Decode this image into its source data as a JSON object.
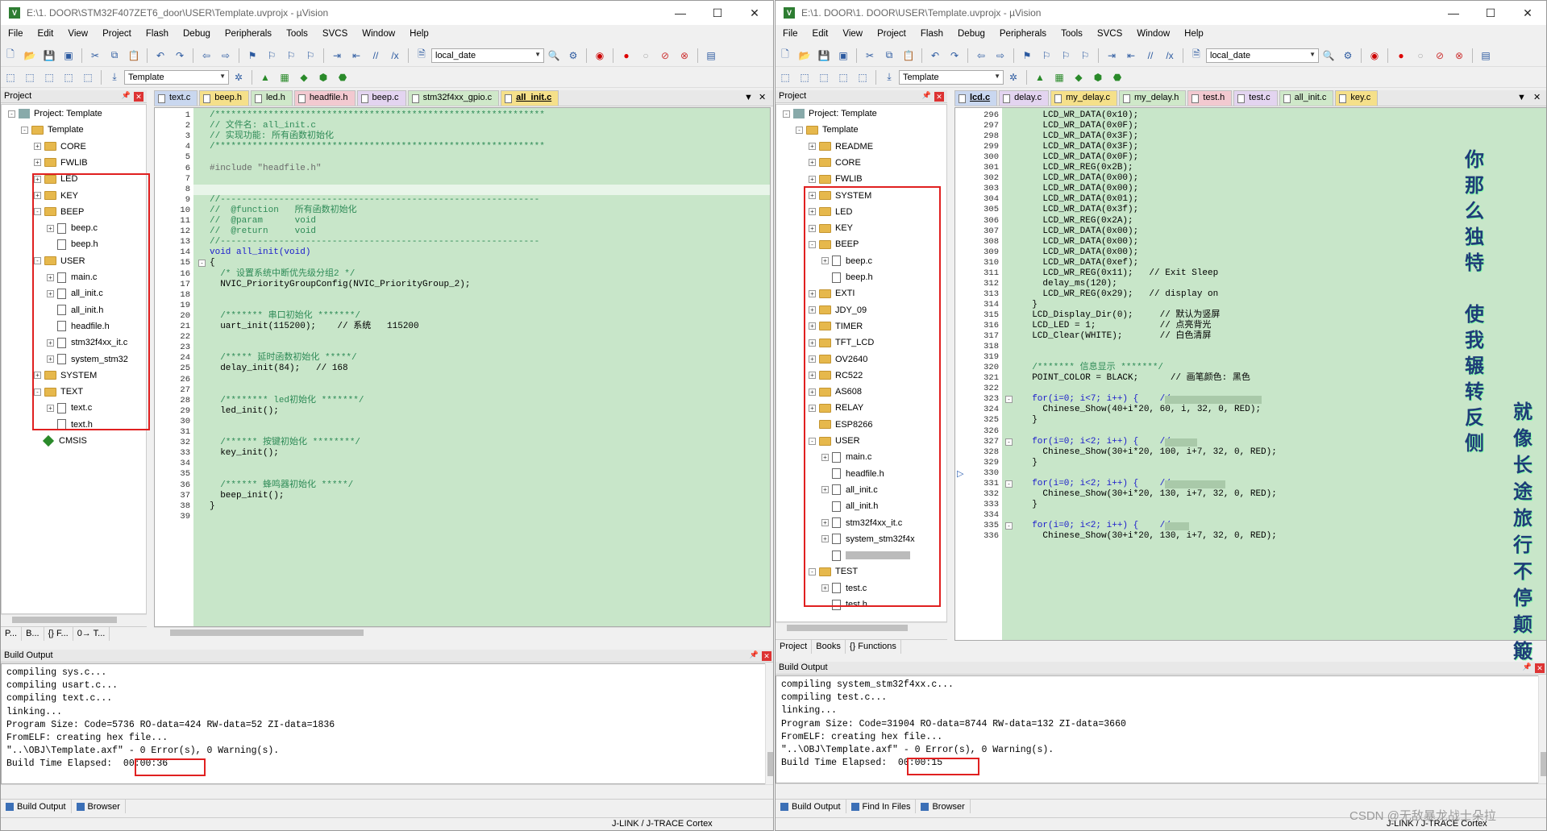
{
  "left": {
    "title": "E:\\1. DOOR\\STM32F407ZET6_door\\USER\\Template.uvprojx - µVision",
    "menu": [
      "File",
      "Edit",
      "View",
      "Project",
      "Flash",
      "Debug",
      "Peripherals",
      "Tools",
      "SVCS",
      "Window",
      "Help"
    ],
    "combo_date": "local_date",
    "combo_target": "Template",
    "panel_title": "Project",
    "tree": [
      {
        "label": "Project: Template",
        "lvl": 0,
        "kind": "proj",
        "exp": "-"
      },
      {
        "label": "Template",
        "lvl": 1,
        "kind": "fold",
        "exp": "-"
      },
      {
        "label": "CORE",
        "lvl": 2,
        "kind": "fold",
        "exp": "+"
      },
      {
        "label": "FWLIB",
        "lvl": 2,
        "kind": "fold",
        "exp": "+"
      },
      {
        "label": "LED",
        "lvl": 2,
        "kind": "fold",
        "exp": "+"
      },
      {
        "label": "KEY",
        "lvl": 2,
        "kind": "fold",
        "exp": "+"
      },
      {
        "label": "BEEP",
        "lvl": 2,
        "kind": "fold",
        "exp": "-"
      },
      {
        "label": "beep.c",
        "lvl": 3,
        "kind": "file",
        "exp": "+"
      },
      {
        "label": "beep.h",
        "lvl": 3,
        "kind": "file",
        "exp": ""
      },
      {
        "label": "USER",
        "lvl": 2,
        "kind": "fold",
        "exp": "-"
      },
      {
        "label": "main.c",
        "lvl": 3,
        "kind": "file",
        "exp": "+"
      },
      {
        "label": "all_init.c",
        "lvl": 3,
        "kind": "file",
        "exp": "+"
      },
      {
        "label": "all_init.h",
        "lvl": 3,
        "kind": "file",
        "exp": ""
      },
      {
        "label": "headfile.h",
        "lvl": 3,
        "kind": "file",
        "exp": ""
      },
      {
        "label": "stm32f4xx_it.c",
        "lvl": 3,
        "kind": "file",
        "exp": "+"
      },
      {
        "label": "system_stm32",
        "lvl": 3,
        "kind": "file",
        "exp": "+"
      },
      {
        "label": "SYSTEM",
        "lvl": 2,
        "kind": "fold",
        "exp": "+"
      },
      {
        "label": "TEXT",
        "lvl": 2,
        "kind": "fold",
        "exp": "-"
      },
      {
        "label": "text.c",
        "lvl": 3,
        "kind": "file",
        "exp": "+"
      },
      {
        "label": "text.h",
        "lvl": 3,
        "kind": "file",
        "exp": ""
      },
      {
        "label": "CMSIS",
        "lvl": 2,
        "kind": "diam",
        "exp": ""
      }
    ],
    "tabs": [
      "text.c",
      "beep.h",
      "led.h",
      "headfile.h",
      "beep.c",
      "stm32f4xx_gpio.c",
      "all_init.c"
    ],
    "tab_colors": [
      "#c9d7ef",
      "#f5e08a",
      "#cfe8c9",
      "#f2c9d0",
      "#e3d4f0",
      "#cfe8c9",
      "#f5e08a"
    ],
    "active_tab": 6,
    "project_tabs": [
      "P...",
      "B...",
      "{} F...",
      "0→ T..."
    ],
    "code": [
      {
        "n": "1",
        "t": "/**************************************************************",
        "c": "c"
      },
      {
        "n": "2",
        "t": "// 文件名: all_init.c",
        "c": "c"
      },
      {
        "n": "3",
        "t": "// 实现功能: 所有函数初始化",
        "c": "c"
      },
      {
        "n": "4",
        "t": "/**************************************************************",
        "c": "c"
      },
      {
        "n": "5",
        "t": "",
        "c": ""
      },
      {
        "n": "6",
        "t": "#include \"headfile.h\"",
        "c": "p"
      },
      {
        "n": "7",
        "t": "",
        "c": ""
      },
      {
        "n": "8",
        "t": "",
        "c": ""
      },
      {
        "n": "9",
        "t": "//------------------------------------------------------------",
        "c": "c"
      },
      {
        "n": "10",
        "t": "//  @function   所有函数初始化",
        "c": "c"
      },
      {
        "n": "11",
        "t": "//  @param      void",
        "c": "c"
      },
      {
        "n": "12",
        "t": "//  @return     void",
        "c": "c"
      },
      {
        "n": "13",
        "t": "//------------------------------------------------------------",
        "c": "c"
      },
      {
        "n": "14",
        "t": "void all_init(void)",
        "c": "k"
      },
      {
        "n": "15",
        "t": "{",
        "c": ""
      },
      {
        "n": "16",
        "t": "  /* 设置系统中断优先级分组2 */",
        "c": "c"
      },
      {
        "n": "17",
        "t": "  NVIC_PriorityGroupConfig(NVIC_PriorityGroup_2);",
        "c": ""
      },
      {
        "n": "18",
        "t": "",
        "c": ""
      },
      {
        "n": "19",
        "t": "",
        "c": ""
      },
      {
        "n": "20",
        "t": "  /******* 串口初始化 *******/",
        "c": "c"
      },
      {
        "n": "21",
        "t": "  uart_init(115200);    // 系统   115200",
        "c": ""
      },
      {
        "n": "22",
        "t": "",
        "c": ""
      },
      {
        "n": "23",
        "t": "",
        "c": ""
      },
      {
        "n": "24",
        "t": "  /***** 延时函数初始化 *****/",
        "c": "c"
      },
      {
        "n": "25",
        "t": "  delay_init(84);   // 168",
        "c": ""
      },
      {
        "n": "26",
        "t": "",
        "c": ""
      },
      {
        "n": "27",
        "t": "",
        "c": ""
      },
      {
        "n": "28",
        "t": "  /******** led初始化 *******/",
        "c": "c"
      },
      {
        "n": "29",
        "t": "  led_init();",
        "c": ""
      },
      {
        "n": "30",
        "t": "",
        "c": ""
      },
      {
        "n": "31",
        "t": "",
        "c": ""
      },
      {
        "n": "32",
        "t": "  /****** 按键初始化 ********/",
        "c": "c"
      },
      {
        "n": "33",
        "t": "  key_init();",
        "c": ""
      },
      {
        "n": "34",
        "t": "",
        "c": ""
      },
      {
        "n": "35",
        "t": "",
        "c": ""
      },
      {
        "n": "36",
        "t": "  /****** 蜂鸣器初始化 *****/",
        "c": "c"
      },
      {
        "n": "37",
        "t": "  beep_init();",
        "c": ""
      },
      {
        "n": "38",
        "t": "}",
        "c": ""
      },
      {
        "n": "39",
        "t": "",
        "c": ""
      }
    ],
    "build_title": "Build Output",
    "build": [
      "compiling sys.c...",
      "compiling usart.c...",
      "compiling text.c...",
      "linking...",
      "Program Size: Code=5736 RO-data=424 RW-data=52 ZI-data=1836",
      "FromELF: creating hex file...",
      "\"..\\OBJ\\Template.axf\" - 0 Error(s), 0 Warning(s).",
      "Build Time Elapsed:  00:00:36"
    ],
    "build_tabs": [
      "Build Output",
      "Browser"
    ],
    "status": "J-LINK / J-TRACE Cortex"
  },
  "right": {
    "title": "E:\\1. DOOR\\1. DOOR\\USER\\Template.uvprojx - µVision",
    "menu": [
      "File",
      "Edit",
      "View",
      "Project",
      "Flash",
      "Debug",
      "Peripherals",
      "Tools",
      "SVCS",
      "Window",
      "Help"
    ],
    "combo_date": "local_date",
    "combo_target": "Template",
    "panel_title": "Project",
    "tree": [
      {
        "label": "Project: Template",
        "lvl": 0,
        "kind": "proj",
        "exp": "-"
      },
      {
        "label": "Template",
        "lvl": 1,
        "kind": "fold",
        "exp": "-"
      },
      {
        "label": "README",
        "lvl": 2,
        "kind": "fold",
        "exp": "+"
      },
      {
        "label": "CORE",
        "lvl": 2,
        "kind": "fold",
        "exp": "+"
      },
      {
        "label": "FWLIB",
        "lvl": 2,
        "kind": "fold",
        "exp": "+"
      },
      {
        "label": "SYSTEM",
        "lvl": 2,
        "kind": "fold",
        "exp": "+"
      },
      {
        "label": "LED",
        "lvl": 2,
        "kind": "fold",
        "exp": "+"
      },
      {
        "label": "KEY",
        "lvl": 2,
        "kind": "fold",
        "exp": "+"
      },
      {
        "label": "BEEP",
        "lvl": 2,
        "kind": "fold",
        "exp": "-"
      },
      {
        "label": "beep.c",
        "lvl": 3,
        "kind": "file",
        "exp": "+"
      },
      {
        "label": "beep.h",
        "lvl": 3,
        "kind": "file",
        "exp": ""
      },
      {
        "label": "EXTI",
        "lvl": 2,
        "kind": "fold",
        "exp": "+"
      },
      {
        "label": "JDY_09",
        "lvl": 2,
        "kind": "fold",
        "exp": "+"
      },
      {
        "label": "TIMER",
        "lvl": 2,
        "kind": "fold",
        "exp": "+"
      },
      {
        "label": "TFT_LCD",
        "lvl": 2,
        "kind": "fold",
        "exp": "+"
      },
      {
        "label": "OV2640",
        "lvl": 2,
        "kind": "fold",
        "exp": "+"
      },
      {
        "label": "RC522",
        "lvl": 2,
        "kind": "fold",
        "exp": "+"
      },
      {
        "label": "AS608",
        "lvl": 2,
        "kind": "fold",
        "exp": "+"
      },
      {
        "label": "RELAY",
        "lvl": 2,
        "kind": "fold",
        "exp": "+"
      },
      {
        "label": "ESP8266",
        "lvl": 2,
        "kind": "fold",
        "exp": ""
      },
      {
        "label": "USER",
        "lvl": 2,
        "kind": "fold",
        "exp": "-"
      },
      {
        "label": "main.c",
        "lvl": 3,
        "kind": "file",
        "exp": "+"
      },
      {
        "label": "headfile.h",
        "lvl": 3,
        "kind": "file",
        "exp": ""
      },
      {
        "label": "all_init.c",
        "lvl": 3,
        "kind": "file",
        "exp": "+"
      },
      {
        "label": "all_init.h",
        "lvl": 3,
        "kind": "file",
        "exp": ""
      },
      {
        "label": "stm32f4xx_it.c",
        "lvl": 3,
        "kind": "file",
        "exp": "+"
      },
      {
        "label": "system_stm32f4x",
        "lvl": 3,
        "kind": "file",
        "exp": "+"
      },
      {
        "label": "",
        "lvl": 3,
        "kind": "file",
        "exp": ""
      },
      {
        "label": "TEST",
        "lvl": 2,
        "kind": "fold",
        "exp": "-"
      },
      {
        "label": "test.c",
        "lvl": 3,
        "kind": "file",
        "exp": "+"
      },
      {
        "label": "test.h",
        "lvl": 3,
        "kind": "file",
        "exp": ""
      }
    ],
    "tabs": [
      "lcd.c",
      "delay.c",
      "my_delay.c",
      "my_delay.h",
      "test.h",
      "test.c",
      "all_init.c",
      "key.c"
    ],
    "tab_colors": [
      "#c9d7ef",
      "#e3d4f0",
      "#f5e08a",
      "#cfe8c9",
      "#f2c9d0",
      "#e3d4f0",
      "#cfe8c9",
      "#f5e08a"
    ],
    "active_tab": 0,
    "project_tabs": [
      "Project",
      "Books",
      "{} Functions"
    ],
    "code": [
      {
        "n": "296",
        "t": "    LCD_WR_DATA(0x10);",
        "c": ""
      },
      {
        "n": "297",
        "t": "    LCD_WR_DATA(0x0F);",
        "c": ""
      },
      {
        "n": "298",
        "t": "    LCD_WR_DATA(0x3F);",
        "c": ""
      },
      {
        "n": "299",
        "t": "    LCD_WR_DATA(0x3F);",
        "c": ""
      },
      {
        "n": "300",
        "t": "    LCD_WR_DATA(0x0F);",
        "c": ""
      },
      {
        "n": "301",
        "t": "    LCD_WR_REG(0x2B);",
        "c": ""
      },
      {
        "n": "302",
        "t": "    LCD_WR_DATA(0x00);",
        "c": ""
      },
      {
        "n": "303",
        "t": "    LCD_WR_DATA(0x00);",
        "c": ""
      },
      {
        "n": "304",
        "t": "    LCD_WR_DATA(0x01);",
        "c": ""
      },
      {
        "n": "305",
        "t": "    LCD_WR_DATA(0x3f);",
        "c": ""
      },
      {
        "n": "306",
        "t": "    LCD_WR_REG(0x2A);",
        "c": ""
      },
      {
        "n": "307",
        "t": "    LCD_WR_DATA(0x00);",
        "c": ""
      },
      {
        "n": "308",
        "t": "    LCD_WR_DATA(0x00);",
        "c": ""
      },
      {
        "n": "309",
        "t": "    LCD_WR_DATA(0x00);",
        "c": ""
      },
      {
        "n": "310",
        "t": "    LCD_WR_DATA(0xef);",
        "c": ""
      },
      {
        "n": "311",
        "t": "    LCD_WR_REG(0x11);   // Exit Sleep",
        "c": ""
      },
      {
        "n": "312",
        "t": "    delay_ms(120);",
        "c": ""
      },
      {
        "n": "313",
        "t": "    LCD_WR_REG(0x29);   // display on",
        "c": ""
      },
      {
        "n": "314",
        "t": "  }",
        "c": ""
      },
      {
        "n": "315",
        "t": "  LCD_Display_Dir(0);     // 默认为竖屏",
        "c": ""
      },
      {
        "n": "316",
        "t": "  LCD_LED = 1;            // 点亮背光",
        "c": ""
      },
      {
        "n": "317",
        "t": "  LCD_Clear(WHITE);       // 白色清屏",
        "c": ""
      },
      {
        "n": "318",
        "t": "",
        "c": ""
      },
      {
        "n": "319",
        "t": "",
        "c": ""
      },
      {
        "n": "320",
        "t": "  /******* 信息显示 *******/",
        "c": "c"
      },
      {
        "n": "321",
        "t": "  POINT_COLOR = BLACK;      // 画笔颜色: 黑色",
        "c": ""
      },
      {
        "n": "322",
        "t": "",
        "c": ""
      },
      {
        "n": "323",
        "t": "  for(i=0; i<7; i++) {    //",
        "c": "k"
      },
      {
        "n": "324",
        "t": "    Chinese_Show(40+i*20, 60, i, 32, 0, RED);",
        "c": ""
      },
      {
        "n": "325",
        "t": "  }",
        "c": ""
      },
      {
        "n": "326",
        "t": "",
        "c": ""
      },
      {
        "n": "327",
        "t": "  for(i=0; i<2; i++) {    //",
        "c": "k"
      },
      {
        "n": "328",
        "t": "    Chinese_Show(30+i*20, 100, i+7, 32, 0, RED);",
        "c": ""
      },
      {
        "n": "329",
        "t": "  }",
        "c": ""
      },
      {
        "n": "330",
        "t": "",
        "c": ""
      },
      {
        "n": "331",
        "t": "  for(i=0; i<2; i++) {    //",
        "c": "k"
      },
      {
        "n": "332",
        "t": "    Chinese_Show(30+i*20, 130, i+7, 32, 0, RED);",
        "c": ""
      },
      {
        "n": "333",
        "t": "  }",
        "c": ""
      },
      {
        "n": "334",
        "t": "",
        "c": ""
      },
      {
        "n": "335",
        "t": "  for(i=0; i<2; i++) {    //",
        "c": "k"
      },
      {
        "n": "336",
        "t": "    Chinese_Show(30+i*20, 130, i+7, 32, 0, RED);",
        "c": ""
      }
    ],
    "poem_col1": [
      "你",
      "那",
      "么",
      "独",
      "特",
      "",
      "使",
      "我",
      "辗",
      "转",
      "反",
      "侧"
    ],
    "poem_col2": [
      "就",
      "像",
      "长",
      "途",
      "旅",
      "行",
      "不",
      "停",
      "颠",
      "簸"
    ],
    "build_title": "Build Output",
    "build": [
      "compiling system_stm32f4xx.c...",
      "compiling test.c...",
      "linking...",
      "Program Size: Code=31904 RO-data=8744 RW-data=132 ZI-data=3660",
      "FromELF: creating hex file...",
      "\"..\\OBJ\\Template.axf\" - 0 Error(s), 0 Warning(s).",
      "Build Time Elapsed:  00:00:15"
    ],
    "build_tabs": [
      "Build Output",
      "Find In Files",
      "Browser"
    ],
    "status": "J-LINK / J-TRACE Cortex",
    "watermark": "CSDN @无敌暴龙战士朵拉"
  }
}
